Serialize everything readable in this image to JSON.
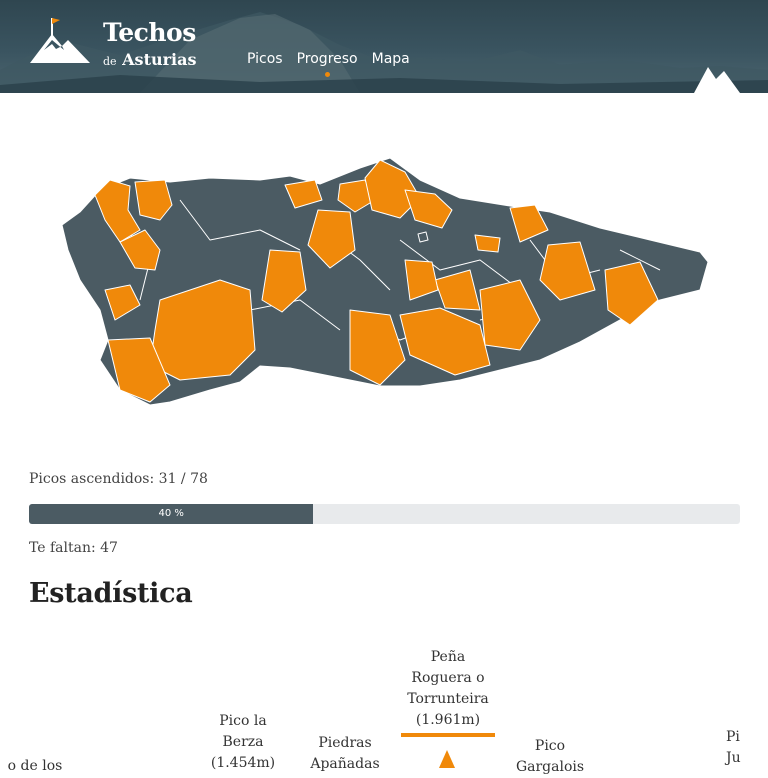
{
  "brand": {
    "title": "Techos",
    "sub_prefix": "de",
    "sub_name": "Asturias"
  },
  "nav": {
    "items": [
      "Picos",
      "Progreso",
      "Mapa"
    ],
    "active": "Progreso"
  },
  "colors": {
    "accent": "#f0890a",
    "region": "#4b5b63",
    "header": "#2f4650"
  },
  "progress": {
    "climbed_text": "Picos ascendidos: 31 / 78",
    "percent_label": "40 %",
    "percent": 40,
    "remaining_text": "Te faltan: 47"
  },
  "stats": {
    "title": "Estadística",
    "peaks": [
      {
        "line1": "",
        "line2": "",
        "line3": "",
        "line4": "o de los"
      },
      {
        "line1": "Pico la",
        "line2": "Berza",
        "line3": "(1.454m)",
        "line4": ""
      },
      {
        "line1": "Piedras",
        "line2": "Apañadas",
        "line3": "",
        "line4": ""
      },
      {
        "line1": "Peña",
        "line2": "Roguera o",
        "line3": "Torrunteira",
        "line4": "(1.961m)"
      },
      {
        "line1": "Pico",
        "line2": "Gargalois",
        "line3": "",
        "line4": ""
      },
      {
        "line1": "Pi",
        "line2": "Ju",
        "line3": "",
        "line4": ""
      }
    ]
  }
}
